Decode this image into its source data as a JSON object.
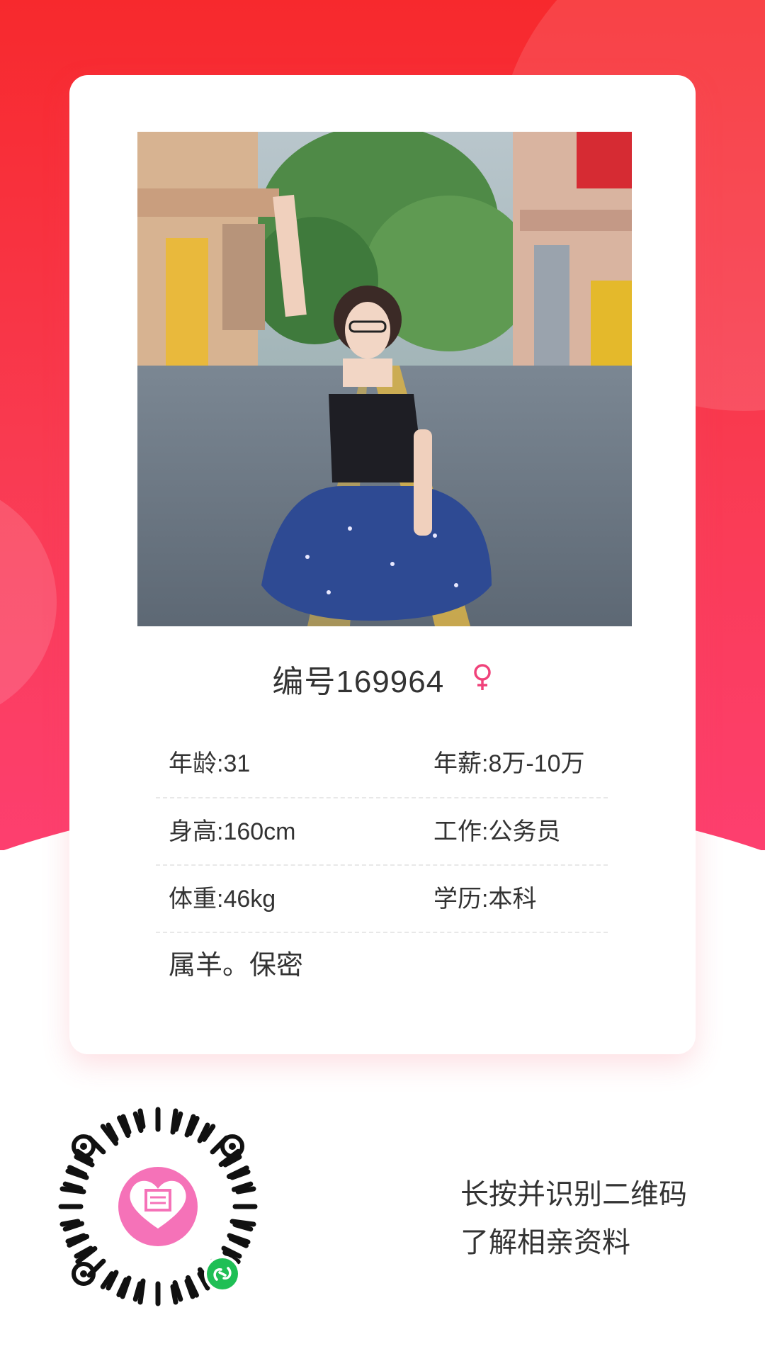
{
  "profile": {
    "id_label": "编号169964",
    "gender_icon": "female-icon",
    "gender_color": "#f0427a",
    "photo_icon": "profile-photo",
    "rows": [
      {
        "left": "年龄:31",
        "right": "年薪:8万-10万"
      },
      {
        "left": "身高:160cm",
        "right": "工作:公务员"
      },
      {
        "left": "体重:46kg",
        "right": "学历:本科"
      }
    ],
    "note": "属羊。保密"
  },
  "footer": {
    "qr_icon": "mini-program-qr-code",
    "line1": "长按并识别二维码",
    "line2": "了解相亲资料"
  },
  "colors": {
    "accent_red": "#f7292d",
    "accent_pink": "#fd3f6f",
    "qr_logo_pink": "#f572b8",
    "qr_badge_green": "#1fbf55"
  }
}
